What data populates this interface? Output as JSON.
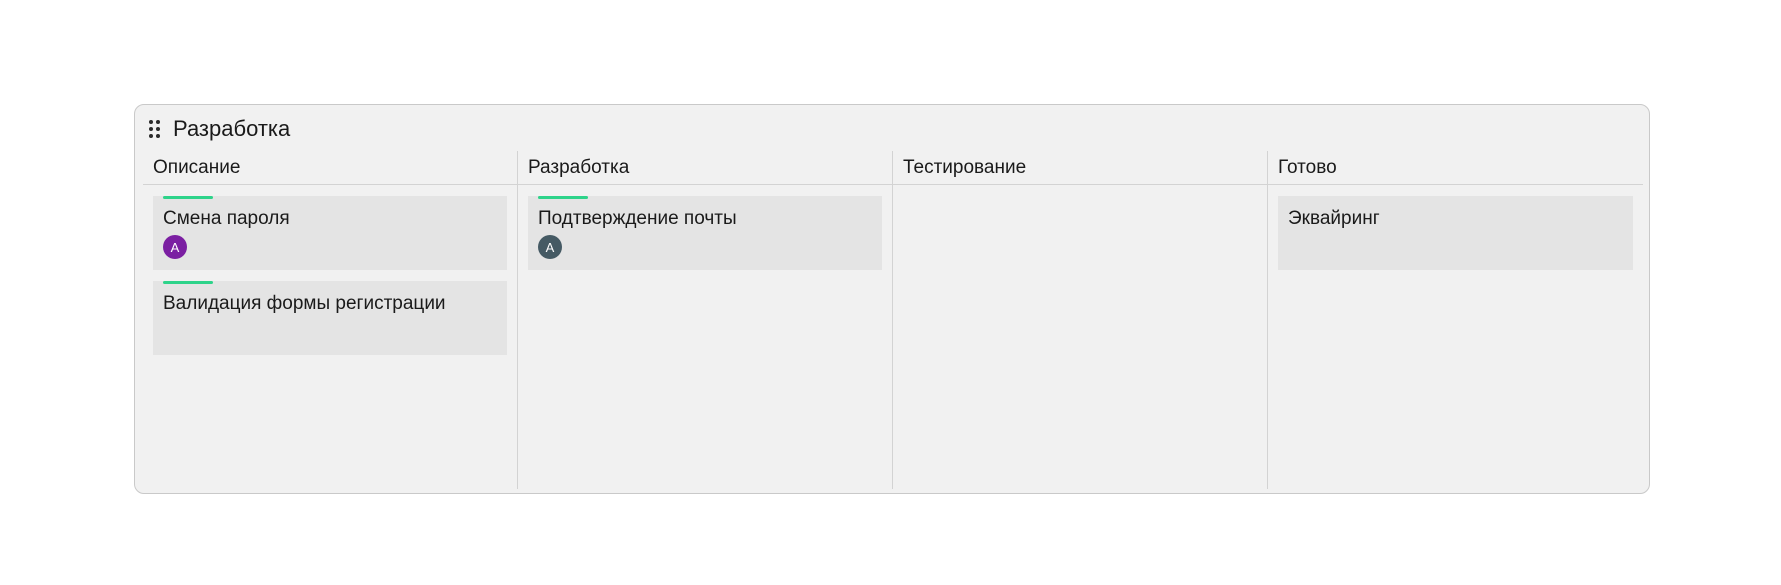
{
  "board": {
    "title": "Разработка",
    "icon": "drag-handle-icon"
  },
  "columns": [
    {
      "label": "Описание",
      "cards": [
        {
          "title": "Смена пароля",
          "accent": true,
          "avatar": {
            "initial": "А",
            "color": "#7b1fa2"
          }
        },
        {
          "title": "Валидация формы регистрации",
          "accent": true
        }
      ]
    },
    {
      "label": "Разработка",
      "cards": [
        {
          "title": "Подтверждение почты",
          "accent": true,
          "avatar": {
            "initial": "А",
            "color": "#455a64"
          }
        }
      ]
    },
    {
      "label": "Тестирование",
      "cards": []
    },
    {
      "label": "Готово",
      "cards": [
        {
          "title": "Эквайринг",
          "accent": false
        }
      ]
    }
  ],
  "colors": {
    "accent": "#2ed38a",
    "board_bg": "#f1f1f1",
    "card_bg": "#e4e4e4"
  }
}
